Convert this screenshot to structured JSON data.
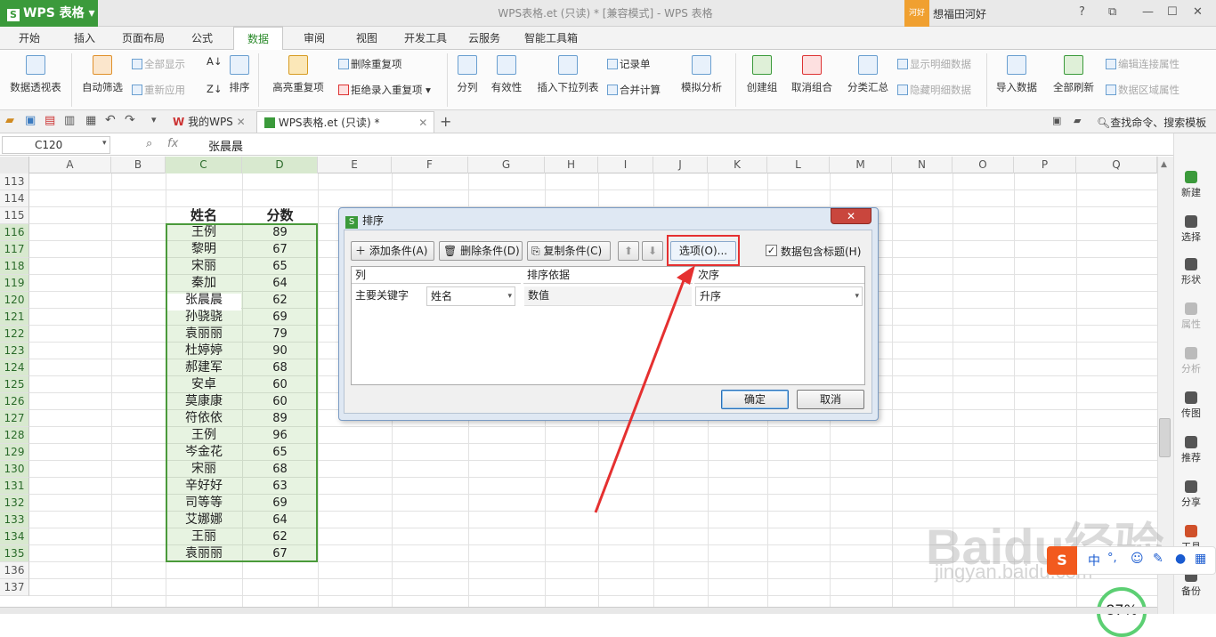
{
  "app": {
    "name": "WPS 表格",
    "logo": "S"
  },
  "window": {
    "title": "WPS表格.et (只读) * [兼容模式] - WPS 表格",
    "user_badge": "河好",
    "user_name": "想福田河好"
  },
  "ribbon_tabs": [
    "开始",
    "插入",
    "页面布局",
    "公式",
    "数据",
    "审阅",
    "视图",
    "开发工具",
    "云服务",
    "智能工具箱"
  ],
  "active_tab": "数据",
  "ribbon": {
    "pivot": "数据透视表",
    "autofilter": "自动筛选",
    "show_all": "全部显示",
    "reapply": "重新应用",
    "sort": "排序",
    "highlight_dup": "高亮重复项",
    "delete_dup": "删除重复项",
    "reject_dup": "拒绝录入重复项",
    "split": "分列",
    "validity": "有效性",
    "insert_dropdown": "插入下拉列表",
    "record": "记录单",
    "consolidate": "合并计算",
    "what_if": "模拟分析",
    "group": "创建组",
    "ungroup": "取消组合",
    "subtotal": "分类汇总",
    "show_detail": "显示明细数据",
    "hide_detail": "隐藏明细数据",
    "import": "导入数据",
    "refresh_all": "全部刷新",
    "edit_conn": "编辑连接属性",
    "range_props": "数据区域属性"
  },
  "doc_tabs": {
    "my_wps": "我的WPS",
    "file": "WPS表格.et (只读) *",
    "search": "查找命令、搜索模板"
  },
  "formula": {
    "cell_ref": "C120",
    "fx": "fx",
    "value": "张晨晨"
  },
  "columns": [
    "A",
    "B",
    "C",
    "D",
    "E",
    "F",
    "G",
    "H",
    "I",
    "J",
    "K",
    "L",
    "M",
    "N",
    "O",
    "P",
    "Q"
  ],
  "rows": [
    "113",
    "114",
    "115",
    "116",
    "117",
    "118",
    "119",
    "120",
    "121",
    "122",
    "123",
    "124",
    "125",
    "126",
    "127",
    "128",
    "129",
    "130",
    "131",
    "132",
    "133",
    "134",
    "135",
    "136",
    "137"
  ],
  "table": {
    "header_name": "姓名",
    "header_score": "分数",
    "names": [
      "王例",
      "黎明",
      "宋丽",
      "秦加",
      "张晨晨",
      "孙骁骁",
      "袁丽丽",
      "杜婷婷",
      "郝建军",
      "安卓",
      "莫康康",
      "符依依",
      "王例",
      "岑金花",
      "宋丽",
      "辛好好",
      "司等等",
      "艾娜娜",
      "王丽",
      "袁丽丽"
    ],
    "scores": [
      "89",
      "67",
      "65",
      "64",
      "62",
      "69",
      "79",
      "90",
      "68",
      "60",
      "60",
      "89",
      "96",
      "65",
      "68",
      "63",
      "69",
      "64",
      "62",
      "67"
    ]
  },
  "sidebar": [
    "新建",
    "选择",
    "形状",
    "属性",
    "分析",
    "传图",
    "推荐",
    "分享",
    "工具",
    "备份"
  ],
  "dialog": {
    "title": "排序",
    "add": "添加条件(A)",
    "delete": "删除条件(D)",
    "copy": "复制条件(C)",
    "up": "⬆",
    "down": "⬇",
    "options": "选项(O)...",
    "has_header": "数据包含标题(H)",
    "col_header": "列",
    "basis_header": "排序依据",
    "order_header": "次序",
    "key_label": "主要关键字",
    "key_value": "姓名",
    "basis_value": "数值",
    "order_value": "升序",
    "ok": "确定",
    "cancel": "取消"
  },
  "ime": {
    "lang": "中",
    "punct": "°,"
  },
  "zoom": "87%",
  "watermark": {
    "brand": "Baidu经验",
    "url": "jingyan.baidu.com"
  },
  "colors": {
    "accent": "#3b9a3b",
    "highlight": "#e53030",
    "selection": "#4a9a3a"
  }
}
